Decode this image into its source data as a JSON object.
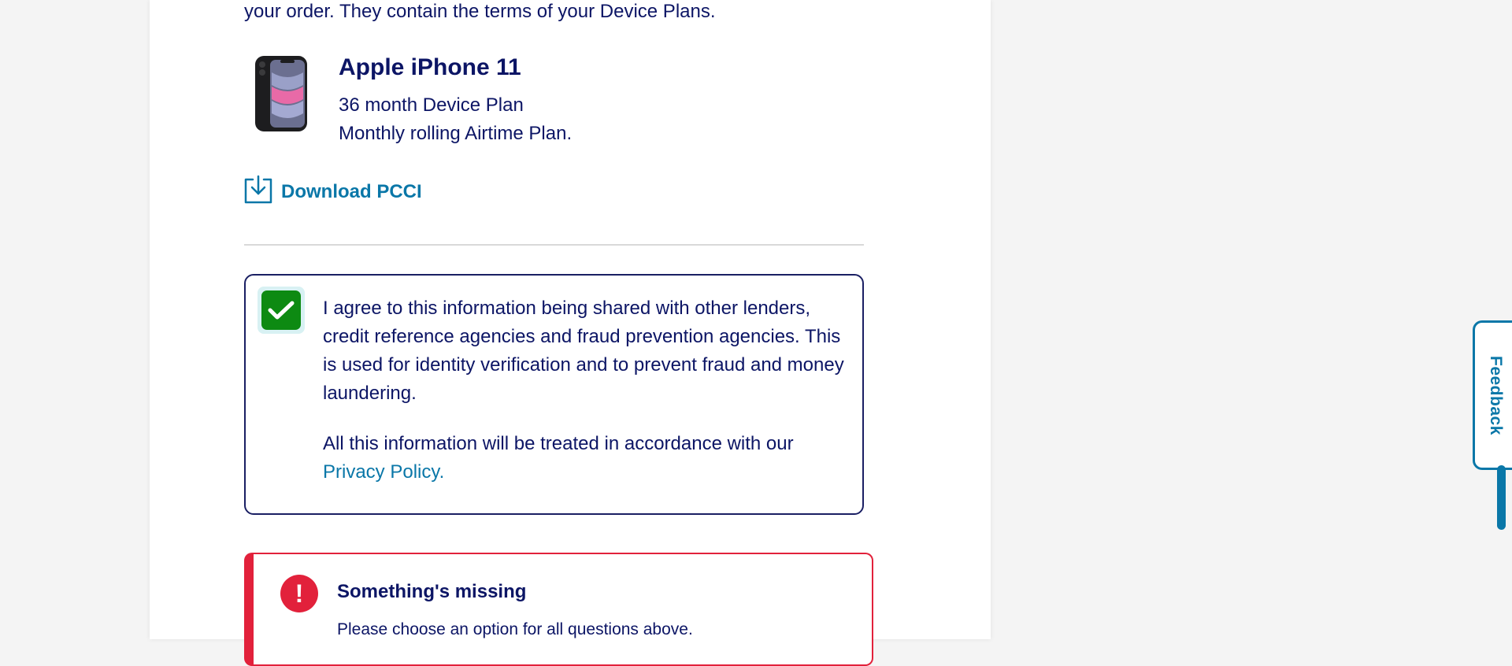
{
  "intro": {
    "text": "your order. They contain the terms of your Device Plans."
  },
  "product": {
    "name": "Apple iPhone 11",
    "device_plan": "36 month Device Plan",
    "airtime_plan": "Monthly rolling Airtime Plan."
  },
  "download": {
    "label": "Download PCCI",
    "icon": "download-icon"
  },
  "consent": {
    "checked": true,
    "paragraph1": "I agree to this information being shared with other lenders, credit reference agencies and fraud prevention agencies. This is used for identity verification and to prevent fraud and money laundering.",
    "paragraph2_prefix": "All this information will be treated in accordance with our ",
    "privacy_link": "Privacy Policy",
    "paragraph2_suffix": ".",
    "check_color": "#0d8a12"
  },
  "error": {
    "icon_glyph": "!",
    "title": "Something's missing",
    "message": "Please choose an option for all questions above.",
    "color": "#e2213b"
  },
  "feedback": {
    "label": "Feedback"
  },
  "colors": {
    "navy": "#0c1565",
    "link": "#0a77a8"
  }
}
